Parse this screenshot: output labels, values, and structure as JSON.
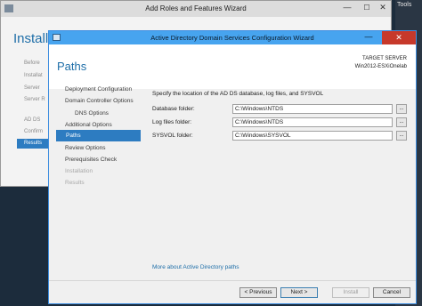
{
  "server_manager": {
    "tools_label": "Tools"
  },
  "back_window": {
    "title": "Add Roles and Features Wizard",
    "min_glyph": "—",
    "max_glyph": "☐",
    "close_glyph": "✕",
    "heading": "Installa",
    "nav": [
      "Before",
      "Installat",
      "Server",
      "Server R",
      "AD DS",
      "Confirm"
    ],
    "selected": "Results"
  },
  "dialog": {
    "title": "Active Directory Domain Services Configuration Wizard",
    "min_glyph": "—",
    "close_glyph": "✕",
    "heading": "Paths",
    "target_label": "TARGET SERVER",
    "target_name": "Win2012-ESXiOnelab",
    "nav": {
      "deployment": "Deployment Configuration",
      "dc_options": "Domain Controller Options",
      "dns_options": "DNS Options",
      "additional": "Additional Options",
      "paths": "Paths",
      "review": "Review Options",
      "prereq": "Prerequisites Check",
      "installation": "Installation",
      "results": "Results"
    },
    "intro": "Specify the location of the AD DS database, log files, and SYSVOL",
    "fields": {
      "database": {
        "label": "Database folder:",
        "value": "C:\\Windows\\NTDS"
      },
      "log": {
        "label": "Log files folder:",
        "value": "C:\\Windows\\NTDS"
      },
      "sysvol": {
        "label": "SYSVOL folder:",
        "value": "C:\\Windows\\SYSVOL"
      }
    },
    "browse_label": "...",
    "more_link": "More about Active Directory paths",
    "buttons": {
      "previous": "< Previous",
      "next": "Next >",
      "install": "Install",
      "cancel": "Cancel"
    }
  },
  "colors": {
    "accent": "#2d7cc1",
    "titlebar": "#47a4ef",
    "close": "#c7392b",
    "link": "#1e6ea8"
  }
}
